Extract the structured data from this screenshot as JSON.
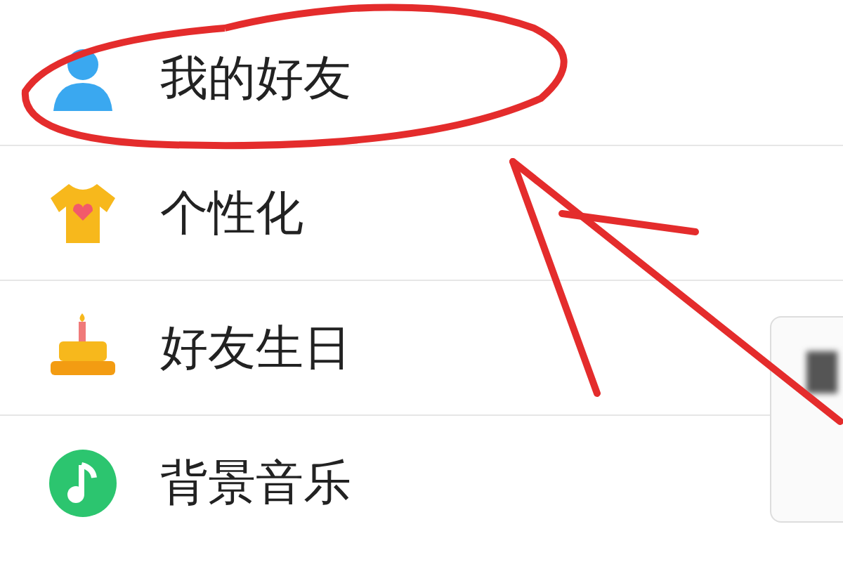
{
  "menu": {
    "items": [
      {
        "kind": "person",
        "label": "我的好友"
      },
      {
        "kind": "shirt",
        "label": "个性化"
      },
      {
        "kind": "cake",
        "label": "好友生日"
      },
      {
        "kind": "music",
        "label": "背景音乐"
      }
    ]
  }
}
